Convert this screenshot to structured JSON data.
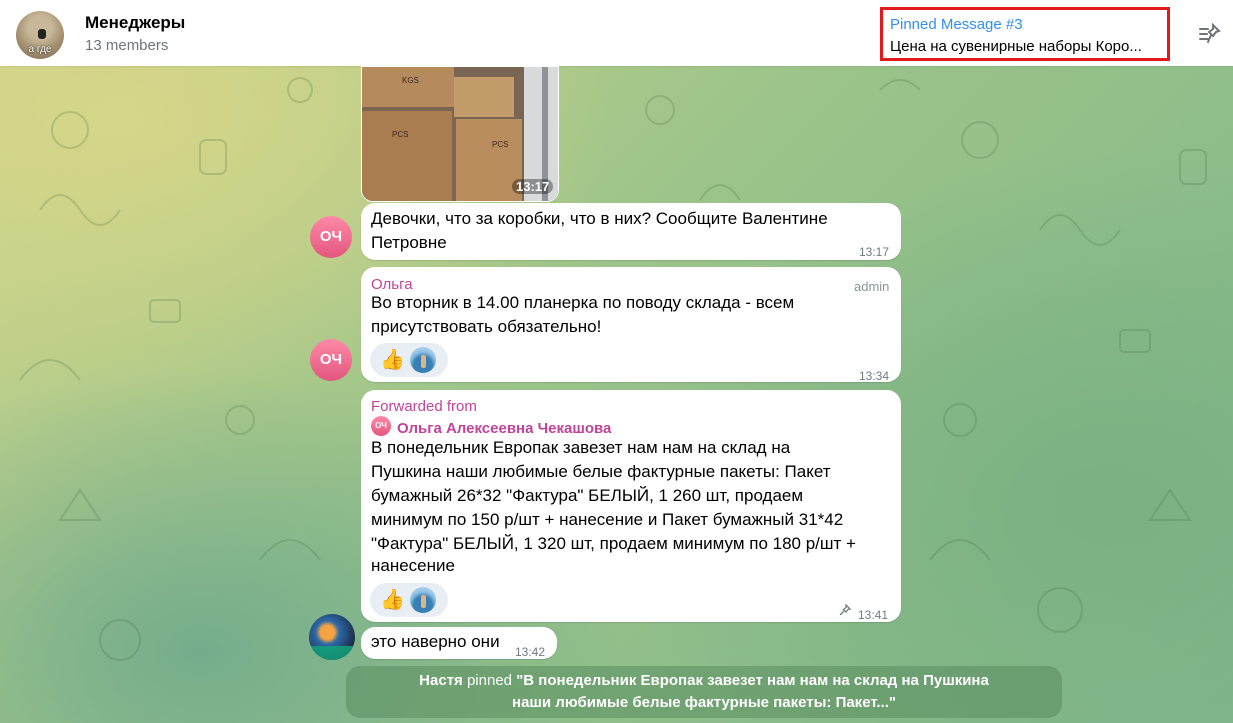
{
  "header": {
    "group_avatar_caption": "а где",
    "title": "Менеджеры",
    "subtitle": "13 members",
    "pinned_label": "Pinned Message #3",
    "pinned_text": "Цена на сувенирные наборы Коро..."
  },
  "messages": [
    {
      "type": "photo",
      "time": "13:17"
    },
    {
      "type": "text",
      "avatar_initials": "ОЧ",
      "line1": "Девочки, что за коробки, что в них? Сообщите Валентине",
      "line2": "Петровне",
      "time": "13:17"
    },
    {
      "type": "text",
      "avatar_initials": "ОЧ",
      "sender": "Ольга",
      "badge": "admin",
      "line1": "Во вторник в 14.00 планерка по поводу склада - всем",
      "line2": "присутствовать обязательно!",
      "reaction": "👍",
      "time": "13:34"
    },
    {
      "type": "forwarded",
      "forwarded_label": "Forwarded from",
      "forwarded_avatar_initials": "ОЧ",
      "forwarded_name": "Ольга Алексеевна Чекашова",
      "lines": [
        "В понедельник Европак завезет нам нам на склад на",
        "Пушкина наши любимые белые фактурные пакеты: Пакет",
        "бумажный 26*32 \"Фактура\" БЕЛЫЙ, 1 260 шт, продаем",
        "минимум по 150 р/шт + нанесение и Пакет бумажный 31*42",
        "\"Фактура\" БЕЛЫЙ, 1 320 шт, продаем минимум по 180 р/шт +",
        "нанесение"
      ],
      "reaction": "👍",
      "pin_glyph": "📌",
      "time": "13:41"
    },
    {
      "type": "text",
      "text": "это наверно они",
      "time": "13:42"
    }
  ],
  "service": {
    "actor": "Настя",
    "action": "pinned",
    "line1": "\"В понедельник Европак завезет нам нам на склад на Пушкина",
    "line2": "наши любимые белые фактурные пакеты: Пакет...\""
  },
  "colors": {
    "accent": "#3390ec",
    "sender": "#c0449a",
    "highlight_border": "#e11b1b"
  }
}
